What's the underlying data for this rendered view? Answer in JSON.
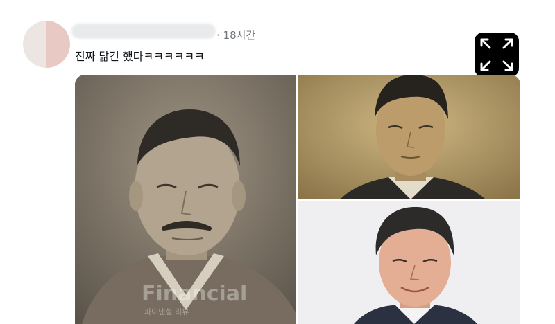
{
  "post": {
    "timestamp": "· 18시간",
    "text": "진짜 닮긴 했다ㅋㅋㅋㅋㅋㅋ"
  },
  "media": {
    "watermark_main": "Financial",
    "watermark_sub": "파이낸셜 리뷰"
  },
  "icons": {
    "expand": "expand-icon"
  },
  "colors": {
    "background": "#ffffff",
    "text_primary": "#0f1419",
    "text_secondary": "#72767a",
    "overlay_button": "#000000"
  }
}
